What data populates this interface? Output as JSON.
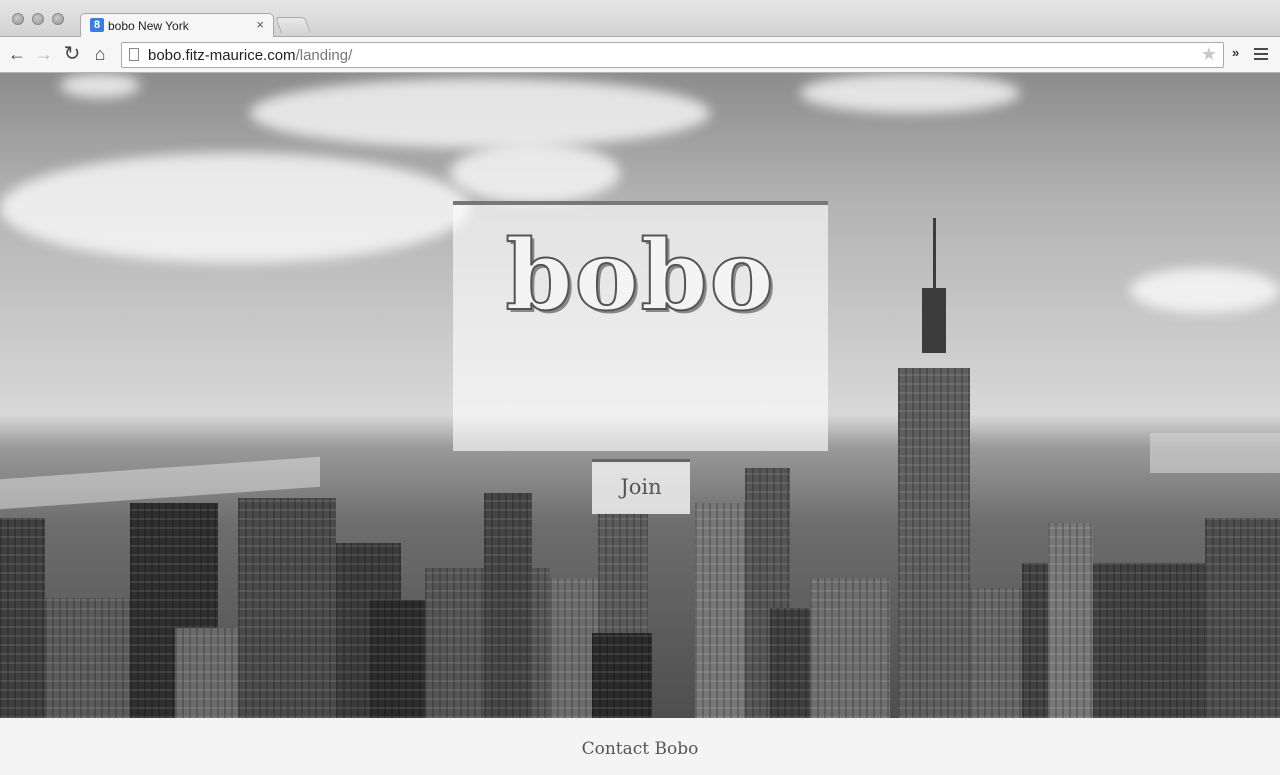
{
  "browser": {
    "tab_title": "bobo New York",
    "tab_favicon_letter": "8",
    "tab_close": "×",
    "url_host": "bobo.fitz-maurice.com",
    "url_path": "/landing/",
    "extensions_chevron": "»"
  },
  "page": {
    "logo": "bobo",
    "join_label": "Join",
    "footer_link": "Contact Bobo"
  },
  "icons": {
    "back": "back-arrow-icon",
    "forward": "forward-arrow-icon",
    "reload": "reload-icon",
    "home": "home-icon",
    "star": "bookmark-star-icon",
    "menu": "hamburger-menu-icon"
  }
}
